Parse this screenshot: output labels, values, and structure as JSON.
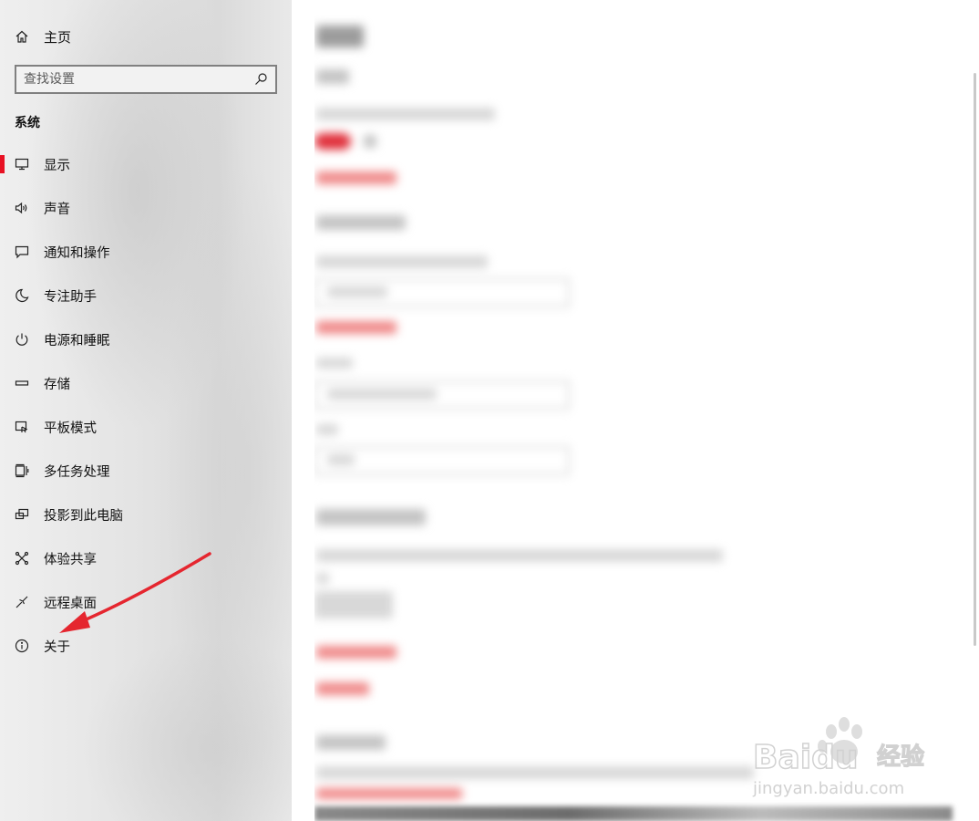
{
  "sidebar": {
    "home_label": "主页",
    "search_placeholder": "查找设置",
    "section_title": "系统",
    "active_item": "显示",
    "items": [
      {
        "label": "显示",
        "icon": "monitor-icon"
      },
      {
        "label": "声音",
        "icon": "speaker-icon"
      },
      {
        "label": "通知和操作",
        "icon": "message-icon"
      },
      {
        "label": "专注助手",
        "icon": "moon-icon"
      },
      {
        "label": "电源和睡眠",
        "icon": "power-icon"
      },
      {
        "label": "存储",
        "icon": "storage-icon"
      },
      {
        "label": "平板模式",
        "icon": "tablet-mode-icon"
      },
      {
        "label": "多任务处理",
        "icon": "multitasking-icon"
      },
      {
        "label": "投影到此电脑",
        "icon": "project-icon"
      },
      {
        "label": "体验共享",
        "icon": "share-icon"
      },
      {
        "label": "远程桌面",
        "icon": "remote-desktop-icon"
      },
      {
        "label": "关于",
        "icon": "info-icon"
      }
    ]
  },
  "annotation": {
    "arrow_color": "#e5262f",
    "points_to": "关于"
  },
  "watermark": {
    "brand": "Baidu",
    "brand_cn": "经验",
    "url": "jingyan.baidu.com"
  },
  "colors": {
    "accent": "#e81123",
    "sidebar_bg": "#e6e6e6",
    "content_bg": "#ffffff"
  }
}
